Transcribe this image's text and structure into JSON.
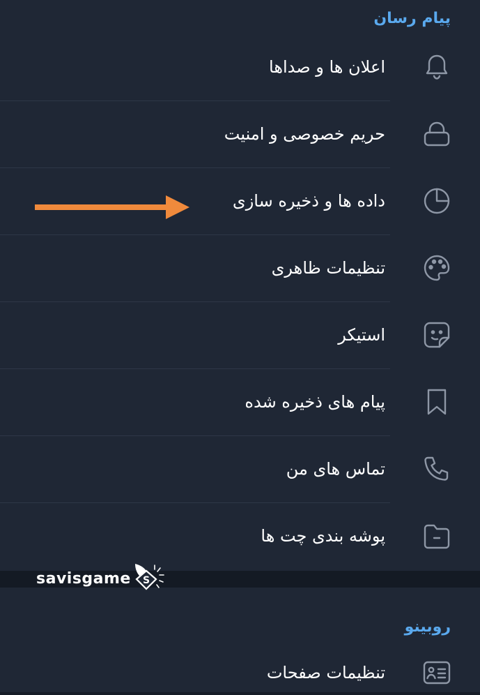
{
  "sections": {
    "messenger": {
      "header": "پیام رسان",
      "items": [
        {
          "label": "اعلان ها و صداها",
          "icon": "bell-icon"
        },
        {
          "label": "حریم خصوصی و امنیت",
          "icon": "lock-icon"
        },
        {
          "label": "داده ها و ذخیره سازی",
          "icon": "pie-chart-icon"
        },
        {
          "label": "تنظیمات ظاهری",
          "icon": "palette-icon"
        },
        {
          "label": "استیکر",
          "icon": "sticker-icon"
        },
        {
          "label": "پیام های ذخیره شده",
          "icon": "bookmark-icon"
        },
        {
          "label": "تماس های من",
          "icon": "phone-icon"
        },
        {
          "label": "پوشه بندی چت ها",
          "icon": "folder-icon"
        }
      ]
    },
    "rubino": {
      "header": "روبینو",
      "items": [
        {
          "label": "تنظیمات صفحات",
          "icon": "profile-card-icon"
        }
      ]
    }
  },
  "annotation": {
    "arrow_color": "#f08a3c",
    "points_to": "داده ها و ذخیره سازی"
  },
  "watermark": {
    "text": "savisgame",
    "logo_letter": "S"
  },
  "colors": {
    "background": "#1f2735",
    "accent": "#5aa9ee",
    "text": "#ffffff",
    "icon": "#8e97a6",
    "divider": "#2e3747"
  }
}
